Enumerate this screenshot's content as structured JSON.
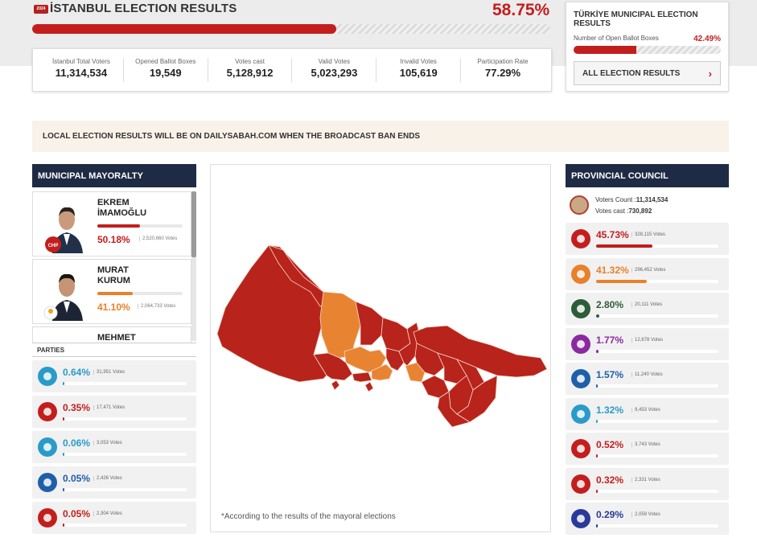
{
  "header": {
    "badge": "2024",
    "title": "İSTANBUL ELECTION RESULTS",
    "opened_pct": "58.75%",
    "opened_fraction": 0.5875
  },
  "stats": [
    {
      "label": "İstanbul Total Voters",
      "value": "11,314,534"
    },
    {
      "label": "Opened Ballot Boxes",
      "value": "19,549"
    },
    {
      "label": "Votes cast",
      "value": "5,128,912"
    },
    {
      "label": "Valid Votes",
      "value": "5,023,293"
    },
    {
      "label": "Invalid Votes",
      "value": "105,619"
    },
    {
      "label": "Participation Rate",
      "value": "77.29%"
    }
  ],
  "turkiye_box": {
    "title": "TÜRKİYE MUNICIPAL ELECTION RESULTS",
    "label": "Number of Open Ballot Boxes",
    "pct": "42.49%",
    "fraction": 0.4249,
    "button_label": "ALL ELECTION RESULTS"
  },
  "notice": "LOCAL ELECTION RESULTS WILL BE ON DAILYSABAH.COM WHEN THE BROADCAST BAN ENDS",
  "mayoralty": {
    "heading": "MUNICIPAL MAYORALTY",
    "candidates": [
      {
        "first": "EKREM",
        "last": "İMAMOĞLU",
        "pct": "50.18%",
        "votes": "2,520,660 Votes",
        "fraction": 0.5018,
        "color": "#c31e1e"
      },
      {
        "first": "MURAT",
        "last": "KURUM",
        "pct": "41.10%",
        "votes": "2,064,733 Votes",
        "fraction": 0.411,
        "color": "#e8812a"
      },
      {
        "first": "MEHMET",
        "last": "",
        "pct": "",
        "votes": "",
        "fraction": 0,
        "color": "#333"
      }
    ],
    "parties_heading": "PARTIES",
    "parties": [
      {
        "pct": "0.64%",
        "votes": "31,951 Votes",
        "fraction": 0.0064,
        "color": "#2a9bc9",
        "logo": "iyi-party-logo"
      },
      {
        "pct": "0.35%",
        "votes": "17,471 Votes",
        "fraction": 0.0035,
        "color": "#c31e1e",
        "logo": "saadet-logo"
      },
      {
        "pct": "0.06%",
        "votes": "3,053 Votes",
        "fraction": 0.0006,
        "color": "#2a9bc9",
        "logo": "yeniden-refah-logo"
      },
      {
        "pct": "0.05%",
        "votes": "2,426 Votes",
        "fraction": 0.0005,
        "color": "#1f5fa8",
        "logo": "deva-logo"
      },
      {
        "pct": "0.05%",
        "votes": "2,304 Votes",
        "fraction": 0.0005,
        "color": "#c31e1e",
        "logo": "party-logo"
      }
    ]
  },
  "map": {
    "note": "*According to the results of the mayoral elections",
    "colors": {
      "red": "#b8231c",
      "orange": "#e88431"
    }
  },
  "provincial": {
    "heading": "PROVINCIAL COUNCIL",
    "voters_count_label": "Voters Count :",
    "voters_count": "11,314,534",
    "votes_cast_label": "Votes cast :",
    "votes_cast": "730,892",
    "parties": [
      {
        "pct": "45.73%",
        "votes": "328,115 Votes",
        "fraction": 0.4573,
        "color": "#c31e1e",
        "logo": "chp-logo"
      },
      {
        "pct": "41.32%",
        "votes": "296,452 Votes",
        "fraction": 0.4132,
        "color": "#e8812a",
        "logo": "akp-logo"
      },
      {
        "pct": "2.80%",
        "votes": "20,111 Votes",
        "fraction": 0.028,
        "color": "#2e5c3a",
        "logo": "yeniden-refah-logo"
      },
      {
        "pct": "1.77%",
        "votes": "12,678 Votes",
        "fraction": 0.0177,
        "color": "#8b2aa0",
        "logo": "dem-logo"
      },
      {
        "pct": "1.57%",
        "votes": "11,240 Votes",
        "fraction": 0.0157,
        "color": "#1f5fa8",
        "logo": "zafer-logo"
      },
      {
        "pct": "1.32%",
        "votes": "9,453 Votes",
        "fraction": 0.0132,
        "color": "#2a9bc9",
        "logo": "iyi-party-logo"
      },
      {
        "pct": "0.52%",
        "votes": "3,743 Votes",
        "fraction": 0.0052,
        "color": "#c31e1e",
        "logo": "saadet-logo"
      },
      {
        "pct": "0.32%",
        "votes": "2,331 Votes",
        "fraction": 0.0032,
        "color": "#c31e1e",
        "logo": "party-logo"
      },
      {
        "pct": "0.29%",
        "votes": "2,059 Votes",
        "fraction": 0.0029,
        "color": "#2a3a9a",
        "logo": "mhp-logo"
      }
    ]
  }
}
